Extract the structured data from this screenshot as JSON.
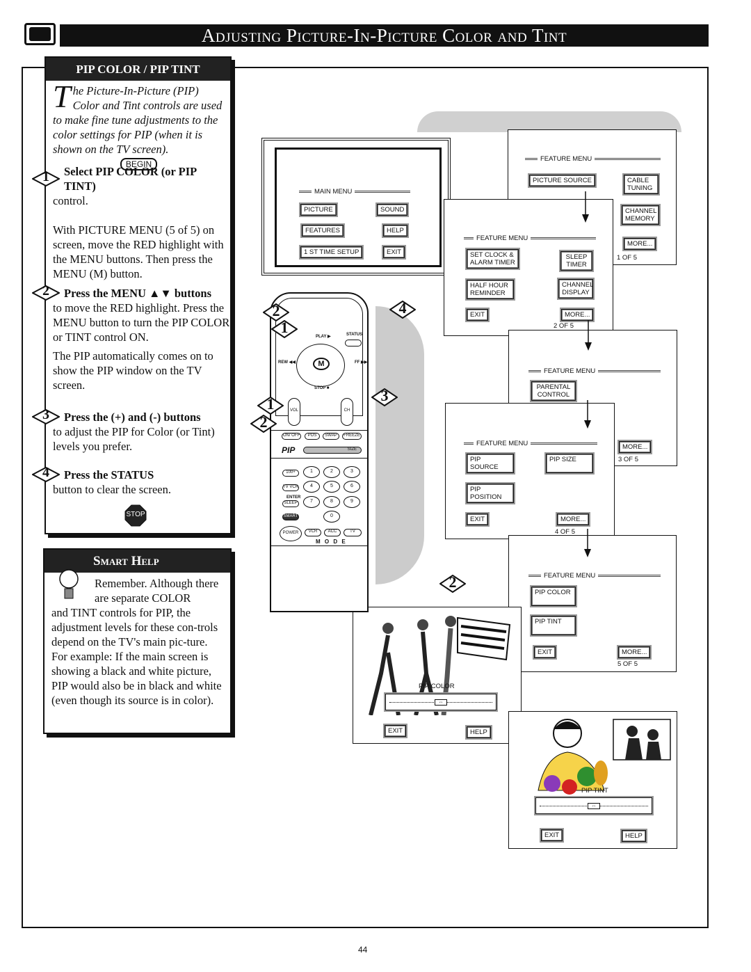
{
  "header": {
    "title": "Adjusting Picture-In-Picture Color and Tint",
    "icon": "tv-icon"
  },
  "left": {
    "heading": "PIP COLOR / PIP TINT",
    "intro_dropcap": "T",
    "intro": "he Picture-In-Picture (PIP) Color and Tint controls are used to make fine tune adjustments to the color settings for PIP (when it is shown on the TV screen).",
    "begin": "BEGIN",
    "steps": [
      {
        "n": "1",
        "bold": "Select PIP COLOR (or PIP TINT)",
        "rest": " control.",
        "body": [
          "With PICTURE MENU (5 of 5) on screen, move the RED highlight with the MENU",
          "buttons. Then press the MENU (M) button."
        ]
      },
      {
        "n": "2",
        "bold": "Press the MENU ▲▼ buttons",
        "rest": "",
        "body": [
          "to move the RED highlight. Press the MENU button to turn the  PIP COLOR or TINT control ON.",
          "The PIP automatically comes on to show the PIP window on the TV screen."
        ]
      },
      {
        "n": "3",
        "bold": "Press the (+) and (-) buttons",
        "rest": " to adjust the PIP for Color (or Tint) levels you prefer.",
        "body": []
      },
      {
        "n": "4",
        "bold": "Press the STATUS",
        "rest": " button to clear the screen.",
        "body": []
      }
    ],
    "stop": "STOP"
  },
  "smart_help": {
    "heading": "Smart Help",
    "text_first": "Remember. Although there are separate COLOR",
    "text": "and TINT controls for PIP, the adjustment levels for these con-trols depend on the TV's main pic-ture. For example: If the main screen is showing a black and white picture, PIP would also be in black and white (even though its source is in color)."
  },
  "main_menu": {
    "title": "MAIN MENU",
    "buttons": [
      "PICTURE",
      "SOUND",
      "FEATURES",
      "HELP",
      "1 ST TIME SETUP",
      "EXIT"
    ]
  },
  "feature_menus": [
    {
      "title": "FEATURE MENU",
      "buttons": [
        "PICTURE SOURCE",
        "CABLE TUNING",
        "CHANNEL MEMORY",
        "MORE..."
      ],
      "page": "1 OF 5"
    },
    {
      "title": "FEATURE MENU",
      "buttons": [
        "SET CLOCK & ALARM TIMER",
        "SLEEP TIMER",
        "HALF HOUR REMINDER",
        "CHANNEL DISPLAY",
        "EXIT",
        "MORE..."
      ],
      "page": "2 OF 5"
    },
    {
      "title": "FEATURE MENU",
      "buttons": [
        "PARENTAL CONTROL",
        "MORE..."
      ],
      "page": "3 OF 5"
    },
    {
      "title": "FEATURE MENU",
      "buttons": [
        "PIP SOURCE",
        "PIP SIZE",
        "PIP POSITION",
        "EXIT",
        "MORE..."
      ],
      "page": "4 OF 5"
    },
    {
      "title": "FEATURE MENU",
      "buttons": [
        "PIP COLOR",
        "PIP TINT",
        "EXIT",
        "MORE..."
      ],
      "page": "5 OF 5"
    }
  ],
  "pip_color_screen": {
    "label": "PIP COLOR",
    "exit": "EXIT",
    "help": "HELP"
  },
  "pip_tint_screen": {
    "label": "PIP TINT",
    "exit": "EXIT",
    "help": "HELP"
  },
  "remote": {
    "play": "PLAY ▶",
    "status": "STATUS",
    "rew": "REW ◀◀",
    "ff": "FF ▶▶",
    "m": "M",
    "stop": "STOP ■",
    "vol": "VOL",
    "ch": "CH",
    "pip_row": [
      "ON/ OFF",
      "POS",
      "SWAP",
      "FREEZE"
    ],
    "pip": "PIP",
    "size": "SIZE",
    "hundred": "100+",
    "tvvcr": "TV VCR",
    "enter": "ENTER",
    "sleep": "SLEEP",
    "smart": "SMART",
    "power": "POWER",
    "modes": [
      "VCR",
      "ACC",
      "TV"
    ],
    "mode_label": "M O D E",
    "digits": [
      "1",
      "2",
      "3",
      "4",
      "5",
      "6",
      "7",
      "8",
      "9",
      "0"
    ]
  },
  "step_badges": [
    "2",
    "1",
    "4",
    "1",
    "3",
    "2",
    "2"
  ],
  "page_number": "44"
}
